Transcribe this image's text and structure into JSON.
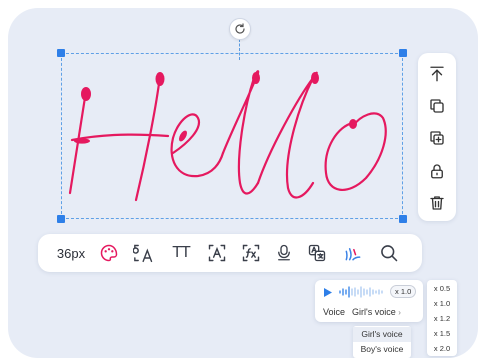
{
  "canvas": {
    "text": "Hello",
    "ink_color": "#e5195f",
    "selection_color": "#2e7fe8"
  },
  "side_toolbar": {
    "icons": [
      "move-to-top-icon",
      "copy-icon",
      "duplicate-icon",
      "lock-icon",
      "delete-icon"
    ]
  },
  "toolbar": {
    "size_label": "36px",
    "text_style_label": "TT",
    "icons": [
      "palette-icon",
      "text-recognition-icon",
      "text-style-icon",
      "text-box-icon",
      "formula-icon",
      "microphone-icon",
      "translate-icon",
      "handwriting-voice-icon",
      "search-icon"
    ]
  },
  "voice_panel": {
    "speed": "x 1.0",
    "voice_label": "Voice",
    "selected_voice": "Girl's voice"
  },
  "speed_options": [
    "x 0.5",
    "x 1.0",
    "x 1.2",
    "x 1.5",
    "x 2.0"
  ],
  "voice_options": [
    "Girl's voice",
    "Boy's voice"
  ],
  "colors": {
    "accent": "#2e7fe8",
    "ink": "#e5195f",
    "background": "#e7ecf6"
  }
}
